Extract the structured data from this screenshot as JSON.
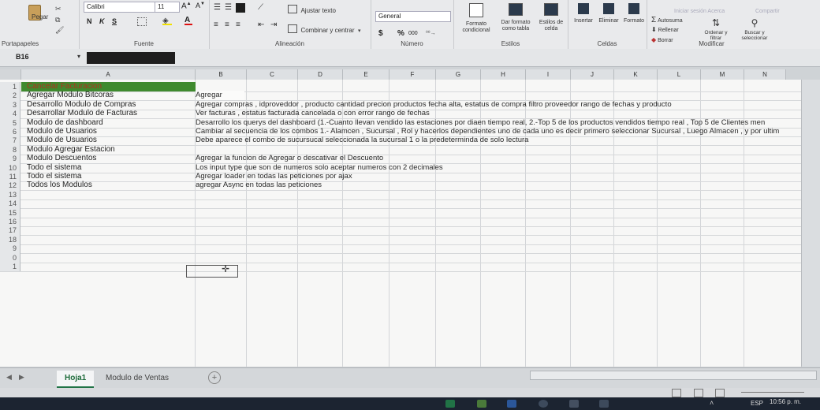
{
  "ribbon": {
    "paste_label": "Pegar",
    "clipboard_label": "Portapapeles",
    "font_name": "Calibri",
    "font_size": "11",
    "font_group_label": "Fuente",
    "bold_label": "N",
    "italic_label": "K",
    "underline_label": "S",
    "wrap_label": "Ajustar texto",
    "merge_label": "Combinar y centrar",
    "alignment_label": "Alineación",
    "number_format": "General",
    "number_label": "Número",
    "currency_symbol": "$",
    "percent_symbol": "%",
    "thousands_label": "000",
    "cond_format_label": "Formato condicional",
    "format_table_label": "Dar formato como tabla",
    "cell_styles_label": "Estilos de celda",
    "styles_group_label": "Estilos",
    "insert_label": "Insertar",
    "delete_label": "Eliminar",
    "format_label": "Formato",
    "cells_group_label": "Celdas",
    "autosum_label": "Autosuma",
    "fill_label": "Rellenar",
    "clear_label": "Borrar",
    "sort_label": "Ordenar y filtrar",
    "find_label": "Buscar y seleccionar",
    "modify_group_label": "Modificar",
    "top_hint": "Iniciar sesión Acerca",
    "share_label": "Compartir"
  },
  "formula_bar": {
    "name_box": "B16"
  },
  "columns": [
    "A",
    "B",
    "C",
    "D",
    "E",
    "F",
    "G",
    "H",
    "I",
    "J",
    "K",
    "L",
    "M",
    "N"
  ],
  "rows": [
    {
      "n": "1",
      "a": "Cancelar Facturacion",
      "b": ""
    },
    {
      "n": "2",
      "a": "Agregar Modulo Bitcoras",
      "b": "Agregar"
    },
    {
      "n": "3",
      "a": "Desarrollo Modulo de Compras",
      "b": "Agregar compras , idproveddor , producto cantidad precion productos fecha alta, estatus de compra  filtro proveedor rango de fechas y producto"
    },
    {
      "n": "4",
      "a": "Desarrollar Modulo de Facturas",
      "b": "Ver facturas , estatus facturada cancelada o con error  rango de fechas"
    },
    {
      "n": "5",
      "a": "Modulo de dashboard",
      "b": "Desarrollo los querys del dashboard (1.-Cuanto llevan vendido las estaciones por diaen tiempo real, 2.-Top 5 de los productos vendidos  tiempo real , Top 5 de Clientes men"
    },
    {
      "n": "6",
      "a": "Modulo de Usuarios",
      "b": "Cambiar al secuencia de los combos 1.- Alamcen , Sucursal  , Rol y hacerlos dependientes uno de cada uno es decir primero seleccionar Sucursal , Luego Almacen , y por ultim"
    },
    {
      "n": "7",
      "a": "Modulo de Usuarios",
      "b": "Debe aparece el combo de sucursucal seleccionada la sucursal 1 o la predeterminda de solo lectura"
    },
    {
      "n": "8",
      "a": "Modulo Agregar Estacion",
      "b": ""
    },
    {
      "n": "9",
      "a": "Modulo Descuentos",
      "b": "Agregar la funcion de Agregar o descativar el Descuento"
    },
    {
      "n": "10",
      "a": "Todo el sistema",
      "b": "Los input type que son de numeros solo aceptar numeros con 2 decimales"
    },
    {
      "n": "11",
      "a": "Todo el sistema",
      "b": "Agregar loader en todas las peticiones por ajax"
    },
    {
      "n": "12",
      "a": "Todos los Modulos",
      "b": "agregar Async en todas las peticiones"
    },
    {
      "n": "13",
      "a": "",
      "b": ""
    },
    {
      "n": "14",
      "a": "",
      "b": ""
    },
    {
      "n": "15",
      "a": "",
      "b": ""
    },
    {
      "n": "16",
      "a": "",
      "b": ""
    },
    {
      "n": "17",
      "a": "",
      "b": ""
    },
    {
      "n": "18",
      "a": "",
      "b": ""
    },
    {
      "n": "9",
      "a": "",
      "b": ""
    },
    {
      "n": "0",
      "a": "",
      "b": ""
    },
    {
      "n": "1",
      "a": "",
      "b": ""
    }
  ],
  "sheets": {
    "tab1": "Hoja1",
    "tab2": "Modulo de Ventas",
    "add": "+"
  },
  "taskbar": {
    "lang": "ESP",
    "time": "10:56 p. m."
  },
  "colors": {
    "header_fill": "#3f8a2e",
    "header_text": "#b0311f",
    "accent": "#217346"
  }
}
